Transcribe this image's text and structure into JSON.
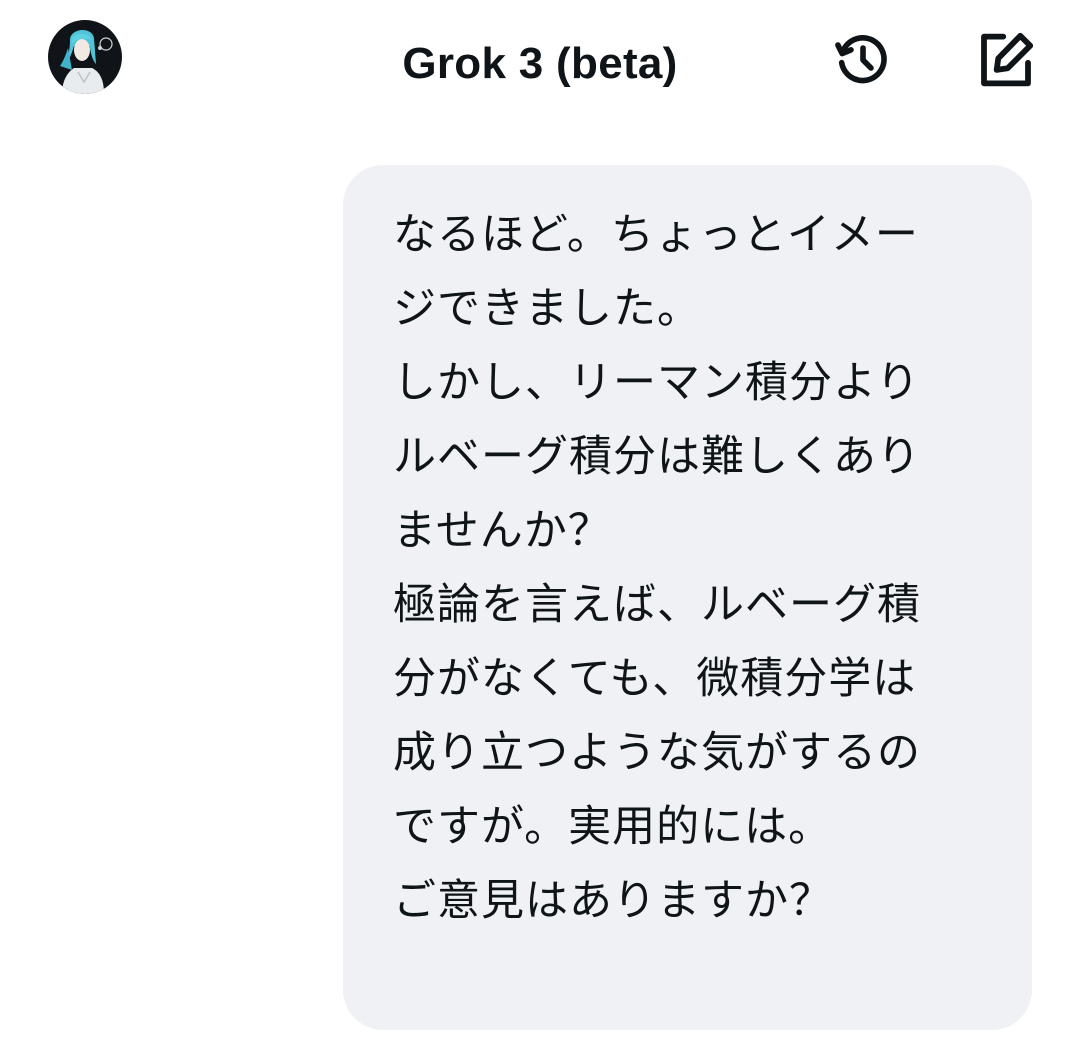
{
  "header": {
    "title": "Grok 3 (beta)",
    "avatar_icon": "avatar-icon",
    "history_icon": "history-icon",
    "compose_icon": "compose-icon"
  },
  "conversation": {
    "messages": [
      {
        "role": "user",
        "text": "なるほど。ちょっとイメージできました。\nしかし、リーマン積分よりルベーグ積分は難しくありませんか？\n極論を言えば、ルベーグ積分がなくても、微積分学は成り立つような気がするのですが。実用的には。\nご意見はありますか？"
      }
    ]
  },
  "colors": {
    "bubble_background": "#eff1f4",
    "text": "#0f1419",
    "icon": "#0f1419",
    "background": "#ffffff"
  }
}
